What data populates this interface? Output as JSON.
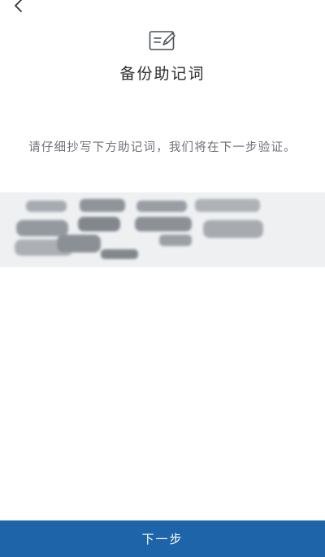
{
  "header": {
    "back_icon": "chevron-left-icon",
    "illustration_icon": "note-edit-icon",
    "title": "备份助记词"
  },
  "main": {
    "instruction": "请仔细抄写下方助记词，我们将在下一步验证。",
    "mnemonic": {
      "state": "obscured",
      "background_color": "#eef0f2"
    }
  },
  "footer": {
    "next_label": "下一步",
    "button_color": "#1d65a8"
  }
}
